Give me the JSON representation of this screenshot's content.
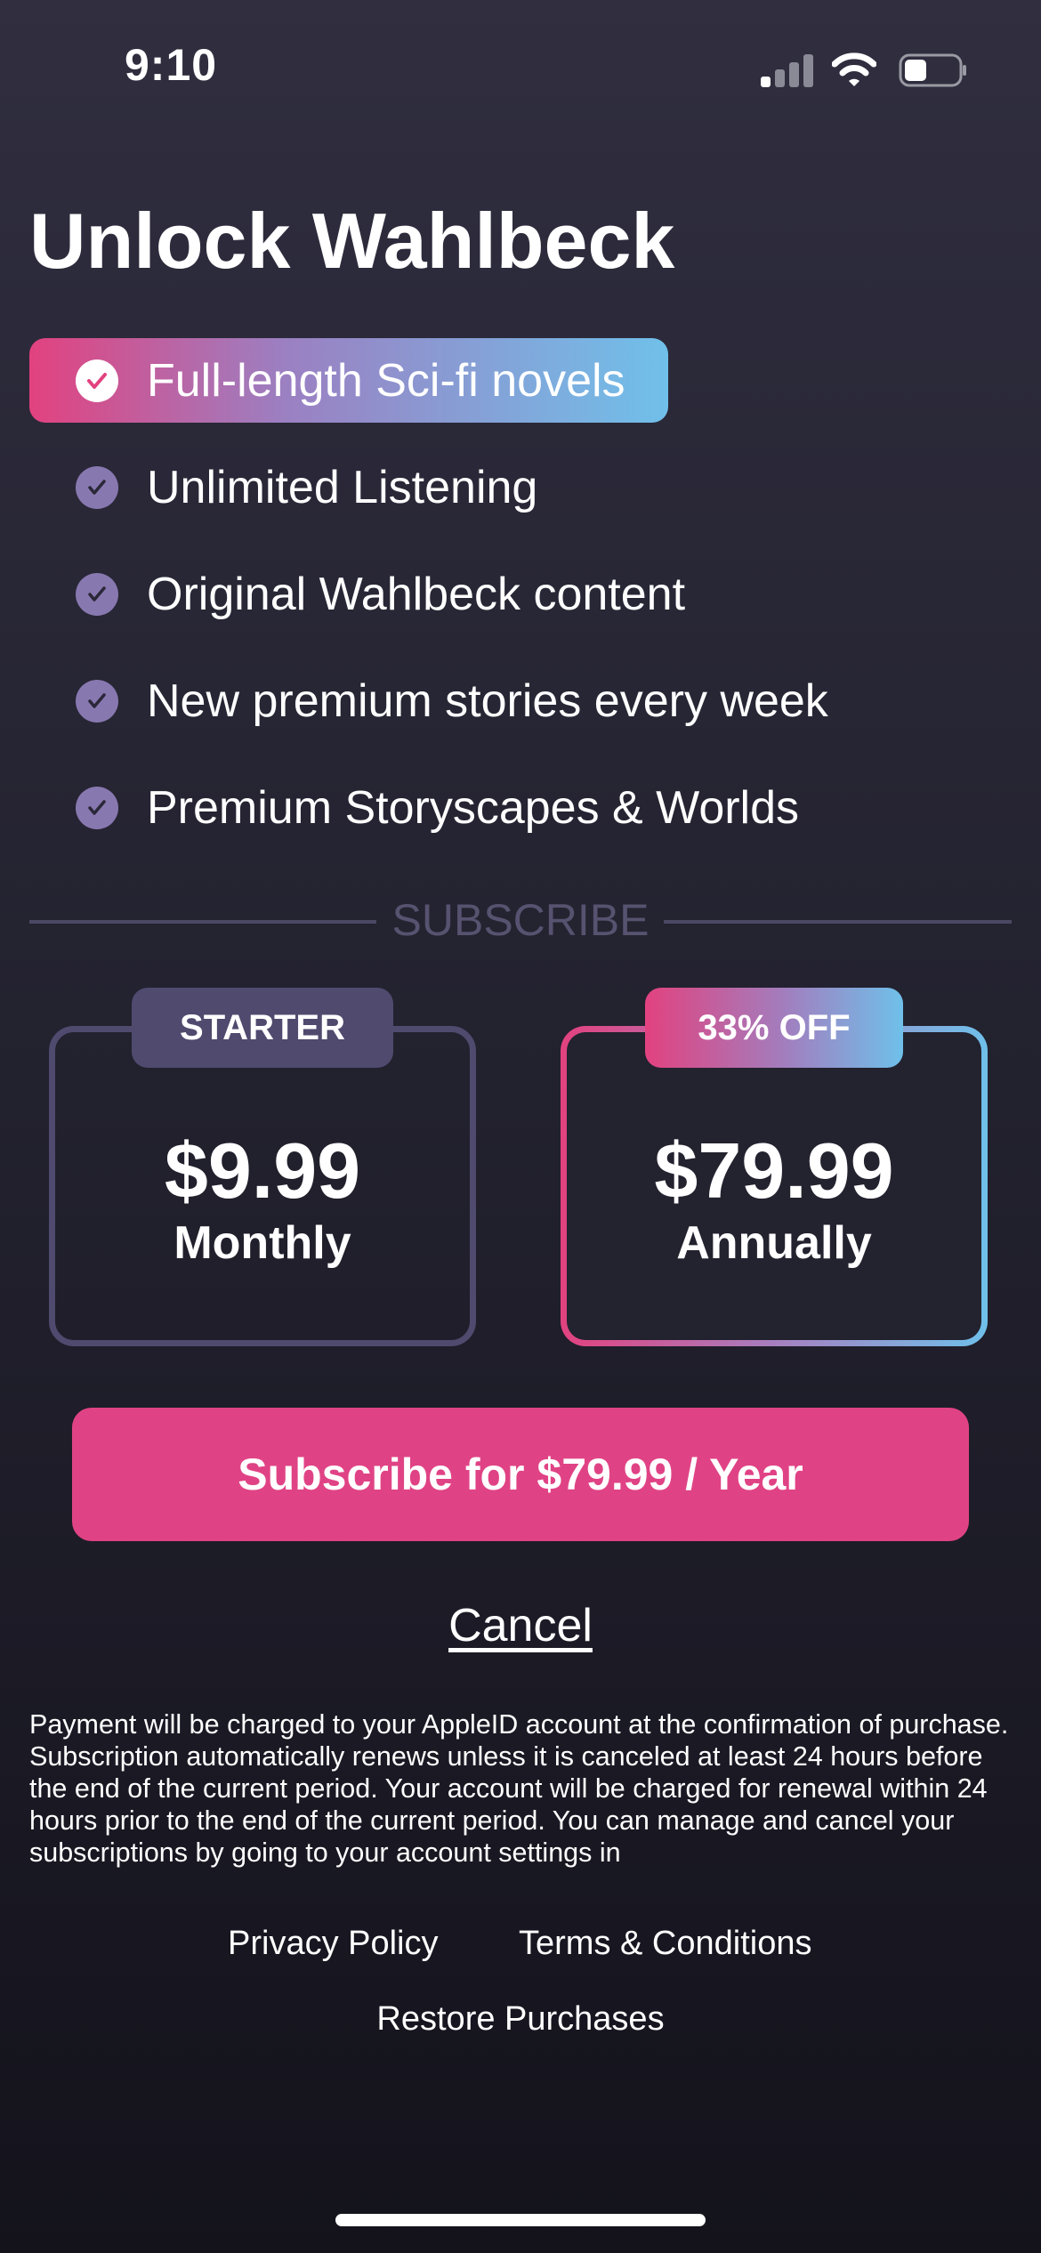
{
  "status_bar": {
    "time": "9:10"
  },
  "title": "Unlock Wahlbeck",
  "features": [
    {
      "label": "Full-length Sci-fi novels",
      "highlighted": true
    },
    {
      "label": "Unlimited Listening"
    },
    {
      "label": "Original Wahlbeck content"
    },
    {
      "label": "New premium stories every week"
    },
    {
      "label": "Premium Storyscapes & Worlds"
    }
  ],
  "divider_label": "SUBSCRIBE",
  "plans": [
    {
      "badge": "STARTER",
      "price": "$9.99",
      "period": "Monthly",
      "selected": false
    },
    {
      "badge": "33% OFF",
      "price": "$79.99",
      "period": "Annually",
      "selected": true
    }
  ],
  "subscribe_button": "Subscribe for $79.99 / Year",
  "cancel": "Cancel",
  "legal_text": "Payment will be charged to your AppleID account at the confirmation of purchase. Subscription automatically renews unless it is canceled at least 24 hours before the end of the current period. Your account will be charged for renewal within 24 hours prior to the end of the current period. You can manage and cancel your subscriptions by going to your account settings in",
  "links": {
    "privacy": "Privacy Policy",
    "terms": "Terms & Conditions",
    "restore": "Restore Purchases"
  },
  "colors": {
    "accent_pink": "#e04385",
    "accent_blue": "#6fc0ea",
    "check_purple": "#8878b0",
    "starter_border": "#4f4a6e"
  },
  "icons": [
    "cellular-signal-icon",
    "wifi-icon",
    "battery-icon",
    "checkmark-icon"
  ]
}
